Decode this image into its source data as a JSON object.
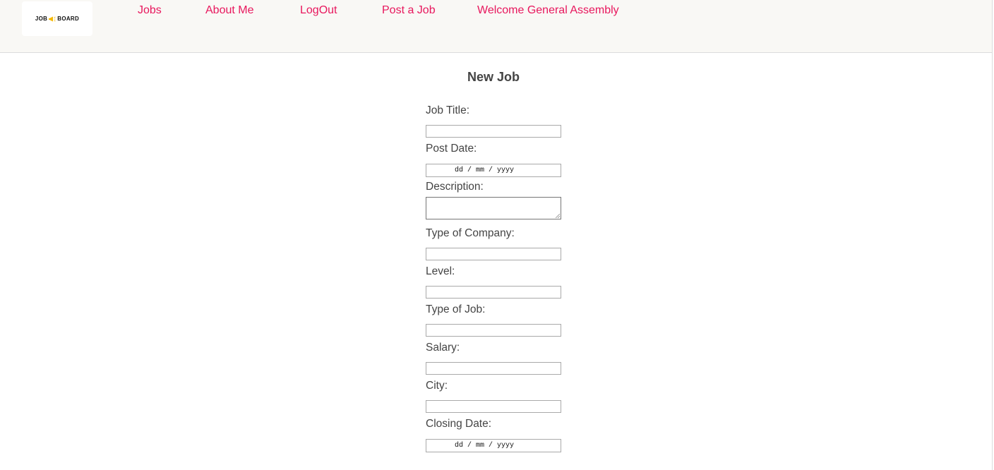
{
  "header": {
    "logo": {
      "text_left": "JOB",
      "text_right": "BOARD",
      "icon": "megaphone-icon",
      "accent_color": "#f5b800"
    },
    "nav": [
      {
        "label": "Jobs"
      },
      {
        "label": "About Me"
      },
      {
        "label": "LogOut"
      },
      {
        "label": "Post a Job"
      },
      {
        "label": "Welcome General Assembly"
      }
    ],
    "link_color": "#e8175d",
    "background": "#f9f8f5"
  },
  "form": {
    "title": "New Job",
    "fields": {
      "job_title": {
        "label": "Job Title:",
        "value": ""
      },
      "post_date": {
        "label": "Post Date:",
        "placeholder": "dd / mm / yyyy"
      },
      "description": {
        "label": "Description:",
        "value": ""
      },
      "type_of_company": {
        "label": "Type of Company:",
        "value": ""
      },
      "level": {
        "label": "Level:",
        "value": ""
      },
      "type_of_job": {
        "label": "Type of Job:",
        "value": ""
      },
      "salary": {
        "label": "Salary:",
        "value": ""
      },
      "city": {
        "label": "City:",
        "value": ""
      },
      "closing_date": {
        "label": "Closing Date:",
        "placeholder": "dd / mm / yyyy"
      }
    }
  }
}
